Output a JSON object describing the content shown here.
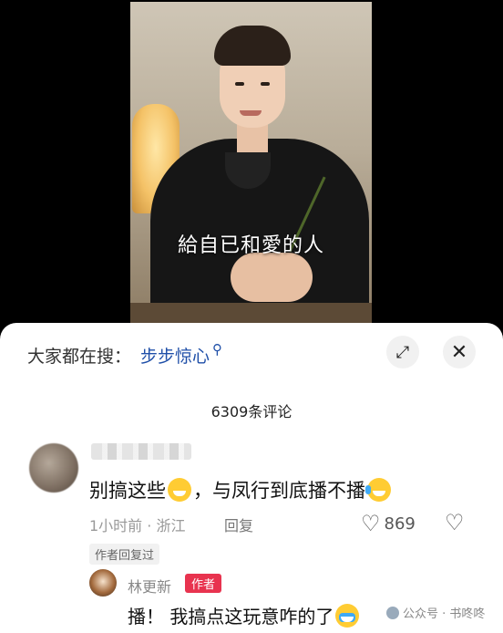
{
  "video": {
    "subtitle": "給自已和愛的人"
  },
  "comment_sheet": {
    "search_prefix": "大家都在搜：",
    "search_term": "步步惊心",
    "comment_count": "6309条评论",
    "comments": [
      {
        "text_before": "别搞这些",
        "text_middle": "，与凤行到底播不播",
        "time": "1小时前 · 浙江",
        "reply_label": "回复",
        "likes": "869",
        "author_replied_badge": "作者回复过"
      }
    ],
    "reply": {
      "user": "林更新",
      "author_tag": "作者",
      "text": "播！ 我搞点这玩意咋的了"
    }
  },
  "watermark": {
    "text": "公众号 · 书咚咚"
  }
}
